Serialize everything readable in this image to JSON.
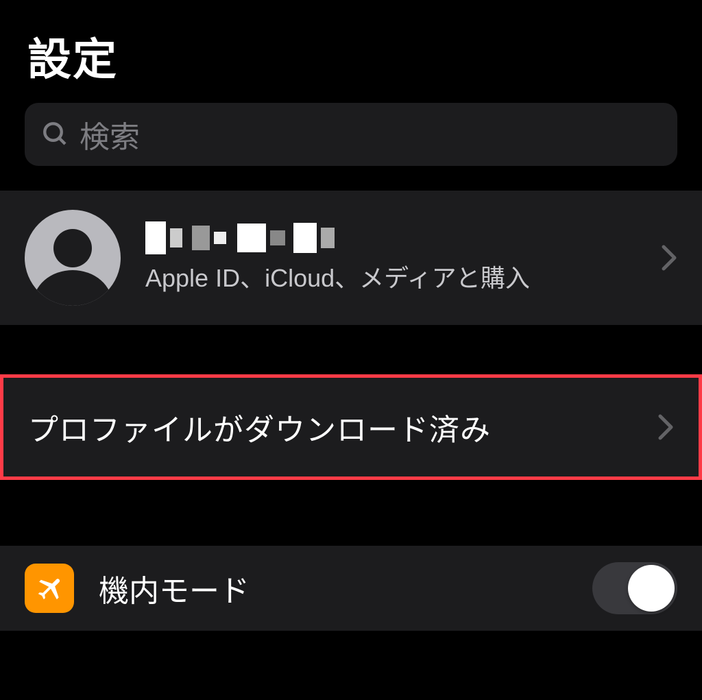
{
  "page": {
    "title": "設定"
  },
  "search": {
    "placeholder": "検索"
  },
  "account": {
    "subtitle": "Apple ID、iCloud、メディアと購入"
  },
  "profile": {
    "label": "プロファイルがダウンロード済み"
  },
  "settings": {
    "airplane": {
      "label": "機内モード",
      "enabled": false
    }
  }
}
